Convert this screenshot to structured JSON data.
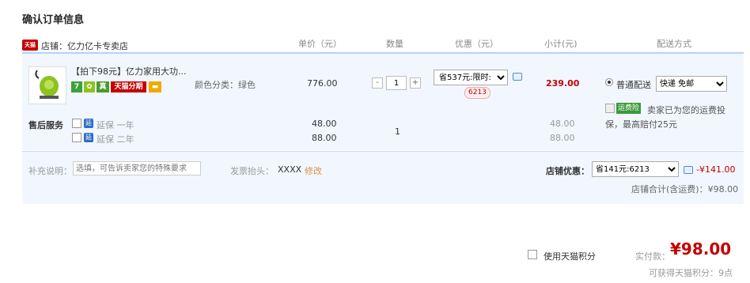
{
  "page_title": "确认订单信息",
  "table_header": {
    "shop_label": "店铺：亿力亿卡专卖店",
    "col_price": "单价（元）",
    "col_qty": "数量",
    "col_promo": "优惠（元）",
    "col_subtotal": "小计(元)",
    "col_shipping": "配送方式"
  },
  "shop_logo_text": "天猫",
  "item": {
    "name": "【拍下98元】亿力家用大功...",
    "badges": [
      "7",
      "真",
      "天猫分期"
    ],
    "sku": "颜色分类：绿色",
    "price": "776.00",
    "qty": "1",
    "qty_minus": "-",
    "qty_plus": "+",
    "promo_select": "省537元:限时:",
    "promo_tag": "6213",
    "subtotal": "239.00",
    "shipping_option": "普通配送",
    "shipping_select": "快递 免邮",
    "insurance_badge": "运费险",
    "insurance_text": "卖家已为您的运费投",
    "insurance_text2": "保，最高赔付25元"
  },
  "after_sales": {
    "label": "售后服务",
    "ext_icon": "延",
    "options": [
      {
        "text": "延保 一年",
        "price": "48.00",
        "subtotal": "48.00"
      },
      {
        "text": "延保 二年",
        "price": "88.00",
        "subtotal": "88.00"
      }
    ],
    "qty": "1"
  },
  "note": {
    "label": "补充说明：",
    "placeholder": "选填，可告诉卖家您的特殊要求",
    "invoice_label": "发票抬头：",
    "invoice_value": "XXXX",
    "invoice_edit": "修改"
  },
  "shop_promo": {
    "label": "店铺优惠：",
    "select": "省141元:6213",
    "discount": "-¥141.00",
    "total": "店铺合计(含运费)：¥98.00"
  },
  "footer": {
    "points_label": "使用天猫积分",
    "pay_label": "实付款：",
    "pay_amount": "¥98.00",
    "earn_points": "可获得天猫积分：9点"
  },
  "colors": {
    "accent_red": "#c40000",
    "header_line": "#b2d1ff",
    "panel_bg": "#f2f7ff"
  }
}
